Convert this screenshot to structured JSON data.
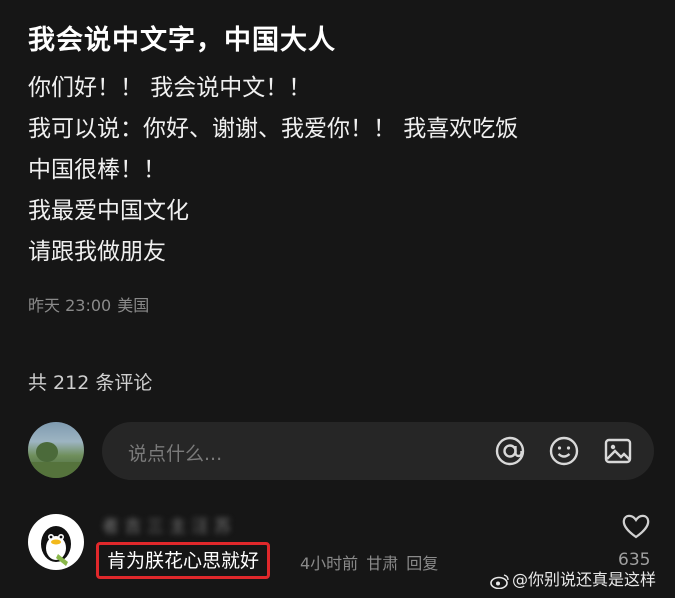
{
  "post": {
    "title": "我会说中文字，中国大人",
    "lines": [
      "你们好！！ 我会说中文！！",
      "我可以说：你好、谢谢、我爱你！！ 我喜欢吃饭",
      "中国很棒！！",
      "我最爱中国文化",
      "请跟我做朋友"
    ],
    "meta": {
      "time": "昨天 23:00",
      "location": "美国"
    }
  },
  "comments_header": {
    "count_label": "共 212 条评论"
  },
  "composer": {
    "placeholder": "说点什么...",
    "icons": [
      "at-icon",
      "emoji-icon",
      "image-icon"
    ]
  },
  "comment": {
    "username": "者 吉 三 主 汪 苏",
    "text": "肯为朕花心思就好",
    "time": "4小时前",
    "location": "甘肃",
    "reply_label": "回复",
    "likes": "635"
  },
  "watermark": {
    "text": "@你别说还真是这样"
  },
  "colors": {
    "background": "#161616",
    "highlight_border": "#e0282b",
    "muted_text": "#8a8a8a"
  }
}
